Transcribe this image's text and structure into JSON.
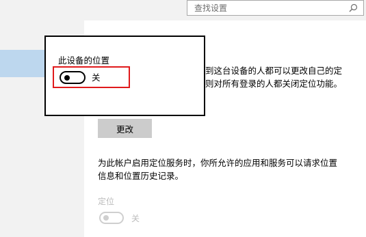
{
  "search": {
    "placeholder": "查找设置"
  },
  "privacy": {
    "description_line1": "到这台设备的人都可以更改自己的定",
    "description_line2": "则对所有登录的人都关闭定位功能。",
    "change_button": "更改",
    "account_text_line1": "为此帐户启用定位服务时，你所允许的应用和服务可以请求位置",
    "account_text_line2": "信息和位置历史记录。",
    "location_heading": "定位",
    "location_toggle_label": "关"
  },
  "dialog": {
    "title": "此设备的位置",
    "toggle_label": "关"
  },
  "colors": {
    "sidebar_selected": "#bdd7ee",
    "highlight_border": "#e0191b",
    "button_bg": "#cccccc",
    "disabled_text": "#bcbcbc"
  },
  "icons": {
    "search": "search-icon"
  }
}
